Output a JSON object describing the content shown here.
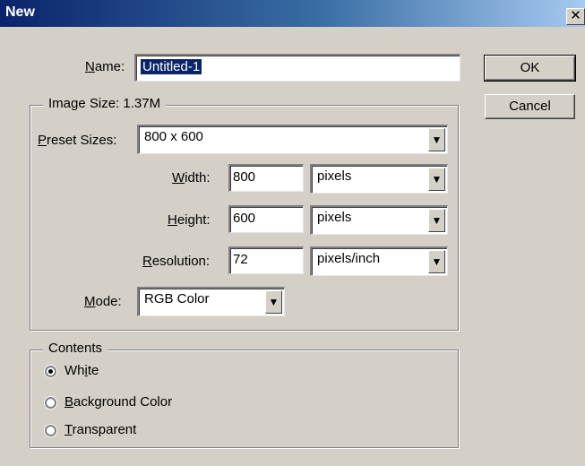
{
  "window": {
    "title": "New"
  },
  "name_field": {
    "label_u": "N",
    "label_rest": "ame:",
    "value": "Untitled-1"
  },
  "buttons": {
    "ok": "OK",
    "cancel": "Cancel"
  },
  "image_size": {
    "legend": "Image Size: 1.37M",
    "preset": {
      "label_u": "P",
      "label_rest": "reset Sizes:",
      "value": "800 x 600"
    },
    "width": {
      "label_u": "W",
      "label_rest": "idth:",
      "value": "800",
      "unit": "pixels"
    },
    "height": {
      "label_u": "H",
      "label_rest": "eight:",
      "value": "600",
      "unit": "pixels"
    },
    "resolution": {
      "label_u": "R",
      "label_rest": "esolution:",
      "value": "72",
      "unit": "pixels/inch"
    },
    "mode": {
      "label_u": "M",
      "label_rest": "ode:",
      "value": "RGB Color"
    }
  },
  "contents": {
    "legend": "Contents",
    "options": [
      {
        "pre": "Wh",
        "u": "i",
        "post": "te",
        "selected": true
      },
      {
        "pre": "",
        "u": "B",
        "post": "ackground Color",
        "selected": false
      },
      {
        "pre": "",
        "u": "T",
        "post": "ransparent",
        "selected": false
      }
    ]
  },
  "icons": {
    "close": "close-icon",
    "dropdown": "chevron-down-icon",
    "radio": "radio-icon"
  },
  "colors": {
    "titlebar_start": "#0a246a",
    "titlebar_end": "#a6caf0",
    "dialog_bg": "#d4d0c8",
    "selection": "#0a246a"
  }
}
